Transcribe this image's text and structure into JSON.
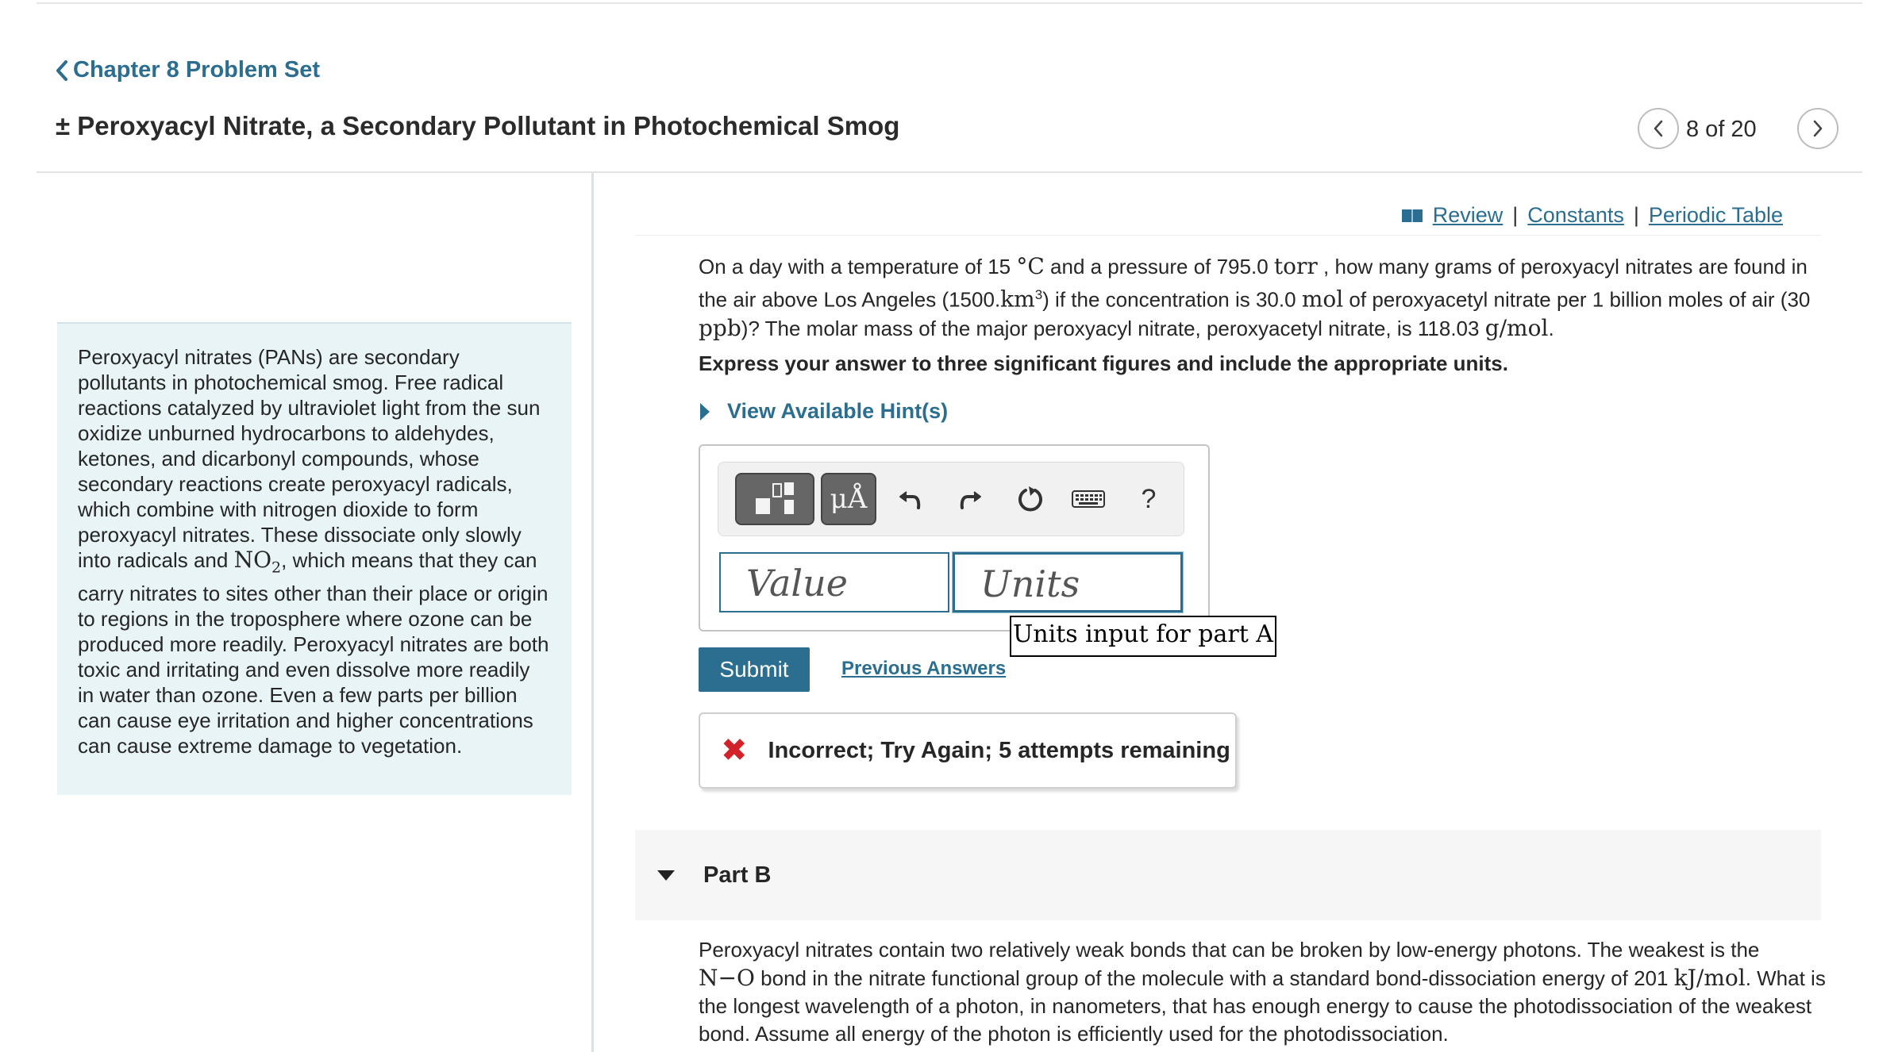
{
  "header": {
    "back_label": "Chapter 8 Problem Set",
    "title": "± Peroxyacyl Nitrate, a Secondary Pollutant in Photochemical Smog",
    "page_count": "8 of 20"
  },
  "intro": {
    "text_before": "Peroxyacyl nitrates (PANs) are secondary pollutants in photochemical smog. Free radical reactions catalyzed by ultraviolet light from the sun oxidize unburned hydrocarbons to aldehydes, ketones, and dicarbonyl compounds, whose secondary reactions create peroxyacyl radicals, which combine with nitrogen dioxide to form peroxyacyl nitrates.  These dissociate only slowly into radicals and",
    "formula_main": "NO",
    "formula_sub": "2",
    "text_after": ", which means that they can carry nitrates to sites other than their place or origin to regions in the troposphere where ozone can be produced more readily.  Peroxyacyl nitrates are both toxic and irritating and even dissolve more readily in water than ozone.  Even a few parts per billion can cause eye irritation and higher concentrations can cause extreme damage to vegetation."
  },
  "links": {
    "review": "Review",
    "constants": "Constants",
    "periodic_table": "Periodic Table",
    "separator": "|"
  },
  "part_a": {
    "q1": "On a day with a temperature of 15",
    "q_deg": "°C",
    "q2": " and a pressure of 795.0",
    "q_torr": "torr",
    "q3": ", how many grams of peroxyacyl nitrates are found in the air above Los Angeles (1500.",
    "q_km": "km",
    "q_km_exp": "3",
    "q4": ") if the concentration is 30.0",
    "q_mol": "mol",
    "q5": " of peroxyacetyl nitrate per 1 billion moles of air (30",
    "q_ppb": "ppb",
    "q6": ")?  The molar mass of the major peroxyacyl nitrate, peroxyacetyl nitrate, is 118.03",
    "q_gmol": "g/mol",
    "q7": ".",
    "instruction": "Express your answer to three significant figures and include the appropriate units.",
    "hints_label": "View Available Hint(s)",
    "toolbar": {
      "units_symbol": "μÅ",
      "help": "?"
    },
    "value_placeholder": "Value",
    "units_placeholder": "Units",
    "tooltip": "Units input for part A",
    "submit_label": "Submit",
    "previous_answers_label": "Previous Answers",
    "feedback_icon": "✖",
    "feedback": "Incorrect; Try Again; 5 attempts remaining"
  },
  "part_b": {
    "label": "Part B",
    "t1": "Peroxyacyl nitrates contain two relatively weak bonds that can be broken by low-energy photons.  The weakest  is the",
    "t_no": "N−O",
    "t2": " bond in the nitrate functional group of the molecule with a standard bond-dissociation energy of 201",
    "t_unit": "kJ/mol",
    "t3": ".  What is the longest wavelength of a photon, in nanometers, that has enough energy to cause the photodissociation of the weakest bond. Assume all energy of the photon is efficiently used for the photodissociation."
  },
  "colors": {
    "link": "#2b6e8f",
    "intro_bg": "#e9f4f6",
    "error": "#d2232a"
  },
  "icons": [
    "chevron-left-icon",
    "chevron-right-icon",
    "book-icon",
    "templates-icon",
    "undo-icon",
    "redo-icon",
    "reset-icon",
    "keyboard-icon",
    "close-x-icon",
    "triangle-right-icon",
    "triangle-down-icon"
  ]
}
